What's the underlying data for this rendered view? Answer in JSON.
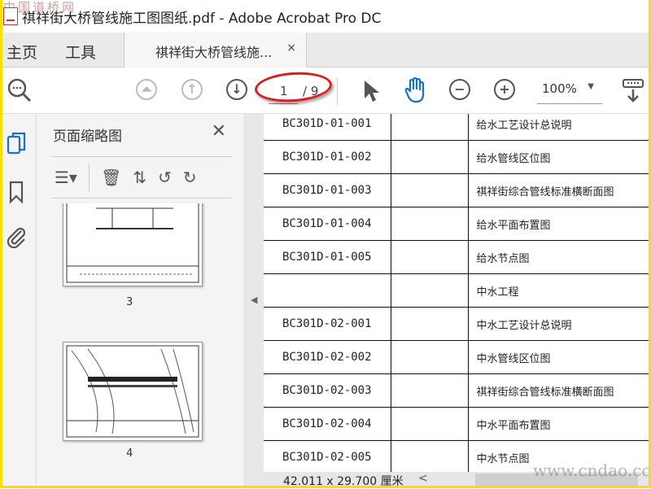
{
  "window": {
    "title": "祺祥街大桥管线施工图图纸.pdf - Adobe Acrobat Pro DC",
    "watermark_top": "中国道桥网",
    "watermark_bottom": "www.cndao.com"
  },
  "tabs": {
    "home": "主页",
    "tools": "工具",
    "document": "祺祥街大桥管线施...",
    "close": "×"
  },
  "toolbar": {
    "page_current": "1",
    "page_total": "/ 9",
    "zoom": "100%",
    "accent": "#1a6fc9",
    "highlight_color": "#d81e1e"
  },
  "panel": {
    "title": "页面缩略图",
    "close": "✕",
    "thumbnails": [
      {
        "label": "3"
      },
      {
        "label": "4"
      }
    ]
  },
  "table": {
    "rows": [
      {
        "code": "BC301D-01-001",
        "name": "给水工艺设计总说明"
      },
      {
        "code": "BC301D-01-002",
        "name": "给水管线区位图"
      },
      {
        "code": "BC301D-01-003",
        "name": "祺祥街综合管线标准横断面图"
      },
      {
        "code": "BC301D-01-004",
        "name": "给水平面布置图"
      },
      {
        "code": "BC301D-01-005",
        "name": "给水节点图"
      },
      {
        "code": "",
        "name": "中水工程"
      },
      {
        "code": "BC301D-02-001",
        "name": "中水工艺设计总说明"
      },
      {
        "code": "BC301D-02-002",
        "name": "中水管线区位图"
      },
      {
        "code": "BC301D-02-003",
        "name": "祺祥街综合管线标准横断面图"
      },
      {
        "code": "BC301D-02-004",
        "name": "中水平面布置图"
      },
      {
        "code": "BC301D-02-005",
        "name": "中水节点图"
      }
    ]
  },
  "status": {
    "dimensions": "42.011 x 29.700 厘米"
  }
}
